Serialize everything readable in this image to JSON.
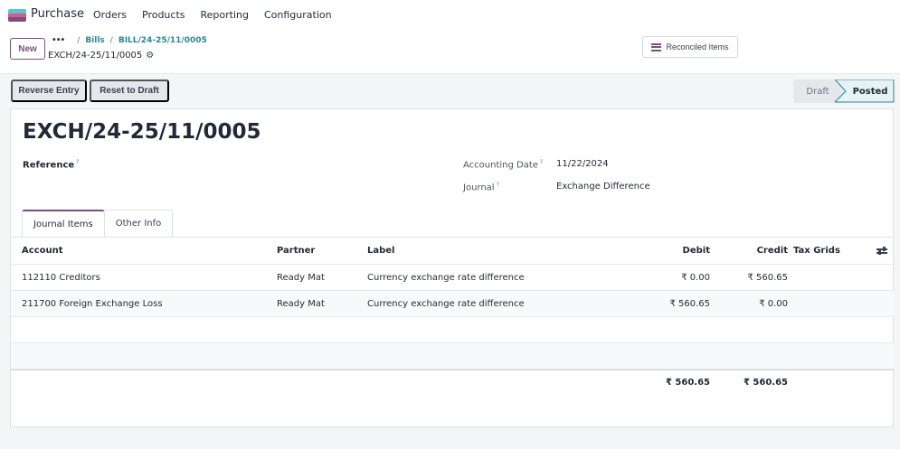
{
  "navbar": {
    "app_name": "Purchase",
    "menu": [
      "Orders",
      "Products",
      "Reporting",
      "Configuration"
    ]
  },
  "control": {
    "new_label": "New",
    "breadcrumb": [
      "Bills",
      "BILL/24-25/11/0005"
    ],
    "record_name": "EXCH/24-25/11/0005",
    "reconciled_label": "Reconciled Items"
  },
  "actions": {
    "reverse_label": "Reverse Entry",
    "reset_label": "Reset to Draft"
  },
  "status": {
    "stages": [
      "Draft",
      "Posted"
    ],
    "current": "Posted"
  },
  "form": {
    "title": "EXCH/24-25/11/0005",
    "reference_label": "Reference",
    "accounting_date_label": "Accounting Date",
    "accounting_date": "11/22/2024",
    "journal_label": "Journal",
    "journal": "Exchange Difference",
    "help_mark": "?"
  },
  "tabs": [
    "Journal Items",
    "Other Info"
  ],
  "table": {
    "headers": {
      "account": "Account",
      "partner": "Partner",
      "label": "Label",
      "debit": "Debit",
      "credit": "Credit",
      "tax_grids": "Tax Grids"
    },
    "rows": [
      {
        "account": "112110 Creditors",
        "partner": "Ready Mat",
        "label": "Currency exchange rate difference",
        "debit": "₹ 0.00",
        "credit": "₹ 560.65"
      },
      {
        "account": "211700 Foreign Exchange Loss",
        "partner": "Ready Mat",
        "label": "Currency exchange rate difference",
        "debit": "₹ 560.65",
        "credit": "₹ 0.00"
      }
    ],
    "totals": {
      "debit": "₹ 560.65",
      "credit": "₹ 560.65"
    }
  },
  "colors": {
    "brand": "#7a4f7f",
    "link": "#2a8793"
  }
}
